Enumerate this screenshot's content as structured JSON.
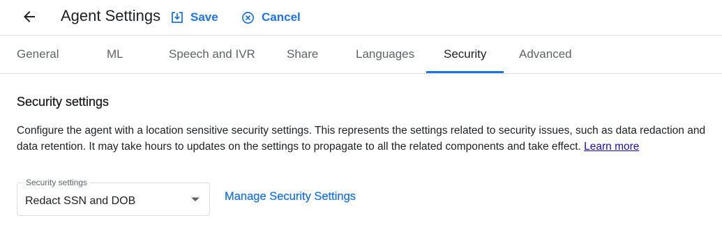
{
  "header": {
    "title": "Agent Settings",
    "save_label": "Save",
    "cancel_label": "Cancel"
  },
  "tabs": [
    {
      "label": "General",
      "active": false
    },
    {
      "label": "ML",
      "active": false
    },
    {
      "label": "Speech and IVR",
      "active": false
    },
    {
      "label": "Share",
      "active": false
    },
    {
      "label": "Languages",
      "active": false
    },
    {
      "label": "Security",
      "active": true
    },
    {
      "label": "Advanced",
      "active": false
    }
  ],
  "section": {
    "title": "Security settings",
    "description": "Configure the agent with a location sensitive security settings. This represents the settings related to security issues, such as data redaction and data retention. It may take hours to updates on the settings to propagate to all the related components and take effect.",
    "learn_more_label": "Learn more"
  },
  "security_select": {
    "label": "Security settings",
    "value": "Redact SSN and DOB"
  },
  "manage_link_label": "Manage Security Settings",
  "colors": {
    "accent": "#1a73e8",
    "text": "#202124",
    "muted": "#5f6368",
    "divider": "#dadce0",
    "link": "#1a0dab"
  },
  "icons": {
    "back": "arrow-back-icon",
    "save": "save-download-icon",
    "cancel": "cancel-circle-x-icon",
    "dropdown": "dropdown-arrow-icon"
  }
}
